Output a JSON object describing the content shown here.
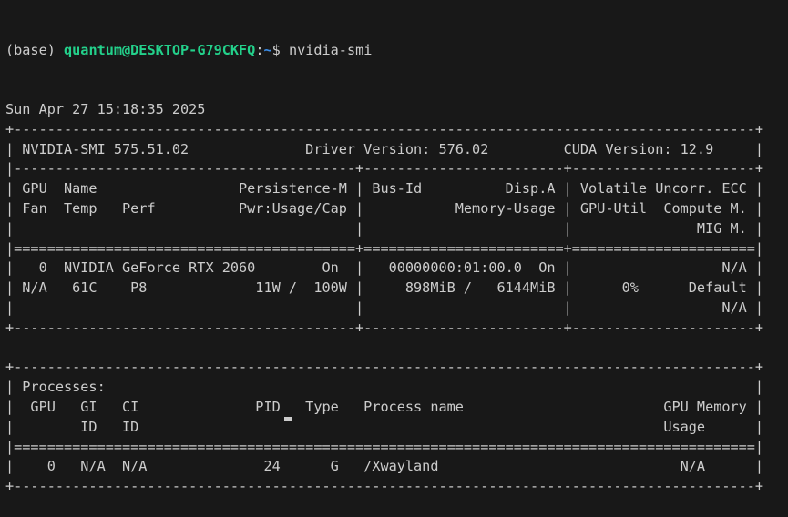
{
  "prompt": {
    "env": "(base) ",
    "user_host": "quantum@DESKTOP-G79CKFQ",
    "colon": ":",
    "path": "~",
    "symbol": "$ ",
    "command": "nvidia-smi"
  },
  "colors": {
    "background": "#181818",
    "text": "#cccccc",
    "user_host": "#23d18b",
    "path": "#3b8eea"
  },
  "output_lines": [
    "Sun Apr 27 15:18:35 2025",
    "+-----------------------------------------------------------------------------------------+",
    "| NVIDIA-SMI 575.51.02              Driver Version: 576.02         CUDA Version: 12.9     |",
    "|-----------------------------------------+------------------------+----------------------+",
    "| GPU  Name                 Persistence-M | Bus-Id          Disp.A | Volatile Uncorr. ECC |",
    "| Fan  Temp   Perf          Pwr:Usage/Cap |           Memory-Usage | GPU-Util  Compute M. |",
    "|                                         |                        |               MIG M. |",
    "|=========================================+========================+======================|",
    "|   0  NVIDIA GeForce RTX 2060        On  |   00000000:01:00.0  On |                  N/A |",
    "| N/A   61C    P8             11W /  100W |     898MiB /   6144MiB |      0%      Default |",
    "|                                         |                        |                  N/A |",
    "+-----------------------------------------+------------------------+----------------------+",
    "",
    "+-----------------------------------------------------------------------------------------+",
    "| Processes:                                                                              |",
    "|  GPU   GI   CI              PID   Type   Process name                        GPU Memory |",
    "|        ID   ID                                                               Usage      |",
    "|=========================================================================================|",
    "|    0   N/A  N/A              24      G   /Xwayland                             N/A      |",
    "+-----------------------------------------------------------------------------------------+"
  ]
}
